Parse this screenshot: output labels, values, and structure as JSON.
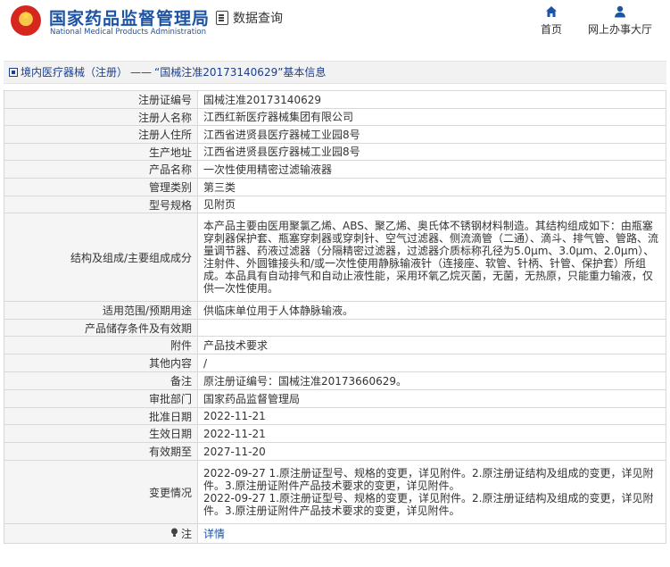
{
  "header": {
    "site_name_cn": "国家药品监督管理局",
    "site_name_en": "National Medical Products Administration",
    "data_query_label": "数据查询",
    "nav_home_label": "首页",
    "nav_online_label": "网上办事大厅"
  },
  "breadcrumb": {
    "category_link": "境内医疗器械（注册）",
    "separator": "——",
    "record_title": "“国械注准20173140629”基本信息"
  },
  "colors": {
    "brand_blue": "#1c53a3",
    "label_bg": "#f5f5f5",
    "border": "#d8d8d8"
  },
  "details": {
    "rows": [
      {
        "label": "注册证编号",
        "value": "国械注准20173140629"
      },
      {
        "label": "注册人名称",
        "value": "江西红新医疗器械集团有限公司"
      },
      {
        "label": "注册人住所",
        "value": "江西省进贤县医疗器械工业园8号"
      },
      {
        "label": "生产地址",
        "value": "江西省进贤县医疗器械工业园8号"
      },
      {
        "label": "产品名称",
        "value": "一次性使用精密过滤输液器"
      },
      {
        "label": "管理类别",
        "value": "第三类"
      },
      {
        "label": "型号规格",
        "value": "见附页"
      },
      {
        "label": "结构及组成/主要组成成分",
        "value": "本产品主要由医用聚氯乙烯、ABS、聚乙烯、奥氏体不锈钢材料制造。其结构组成如下：由瓶塞穿刺器保护套、瓶塞穿刺器或穿刺针、空气过滤器、侧流滴管（二通）、滴斗、排气管、管路、流量调节器、药液过滤器（分隔精密过滤器，过滤器介质标称孔径为5.0μm、3.0μm、2.0μm）、注射件、外圆锥接头和/或一次性使用静脉输液针（连接座、软管、针柄、针管、保护套）所组成。本品具有自动排气和自动止液性能，采用环氧乙烷灭菌，无菌，无热原，只能重力输液，仅供一次性使用。"
      },
      {
        "label": "适用范围/预期用途",
        "value": "供临床单位用于人体静脉输液。"
      },
      {
        "label": "产品储存条件及有效期",
        "value": ""
      },
      {
        "label": "附件",
        "value": "产品技术要求"
      },
      {
        "label": "其他内容",
        "value": "/"
      },
      {
        "label": "备注",
        "value": "原注册证编号：国械注准20173660629。"
      },
      {
        "label": "审批部门",
        "value": "国家药品监督管理局"
      },
      {
        "label": "批准日期",
        "value": "2022-11-21"
      },
      {
        "label": "生效日期",
        "value": "2022-11-21"
      },
      {
        "label": "有效期至",
        "value": "2027-11-20"
      },
      {
        "label": "变更情况",
        "value": "2022-09-27 1.原注册证型号、规格的变更，详见附件。2.原注册证结构及组成的变更，详见附件。3.原注册证附件产品技术要求的变更，详见附件。\n2022-09-27 1.原注册证型号、规格的变更，详见附件。2.原注册证结构及组成的变更，详见附件。3.原注册证附件产品技术要求的变更，详见附件。"
      }
    ],
    "note_label": "注",
    "note_link": "详情"
  }
}
